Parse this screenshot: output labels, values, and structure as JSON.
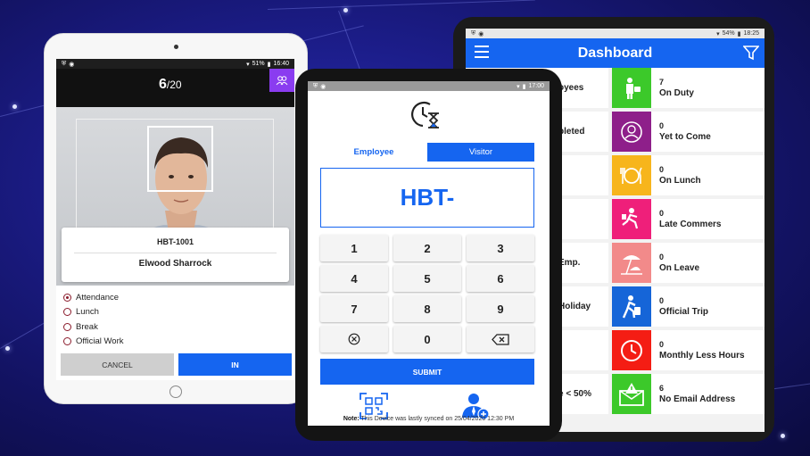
{
  "face_screen": {
    "status_time": "16:40",
    "status_battery": "51%",
    "counter_current": "6",
    "counter_total": "/20",
    "employee_code": "HBT-1001",
    "employee_name": "Elwood Sharrock",
    "options": [
      {
        "label": "Attendance",
        "selected": true
      },
      {
        "label": "Lunch",
        "selected": false
      },
      {
        "label": "Break",
        "selected": false
      },
      {
        "label": "Official Work",
        "selected": false
      }
    ],
    "cancel_label": "CANCEL",
    "in_label": "IN"
  },
  "keypad_screen": {
    "status_time": "17:00",
    "tab_employee": "Employee",
    "tab_visitor": "Visitor",
    "code_value": "HBT-",
    "keys": [
      "1",
      "2",
      "3",
      "4",
      "5",
      "6",
      "7",
      "8",
      "9",
      "",
      "0",
      ""
    ],
    "submit_label": "SUBMIT",
    "note_label": "Note:",
    "note_text": " This Device was lastly synced on 25/04/2020 12:30 PM"
  },
  "dashboard": {
    "status_time": "18:25",
    "status_battery": "54%",
    "title": "Dashboard",
    "left_labels": [
      "oyees",
      "pleted",
      "",
      "",
      "Emp.",
      "Holiday",
      "",
      "e < 50%"
    ],
    "tiles": [
      {
        "count": "7",
        "label": "On Duty",
        "color": "#3cc92a",
        "icon": "on-duty-icon"
      },
      {
        "count": "0",
        "label": "Yet to Come",
        "color": "#8e1f8a",
        "icon": "yet-to-come-icon"
      },
      {
        "count": "0",
        "label": "On Lunch",
        "color": "#f7b51c",
        "icon": "lunch-icon"
      },
      {
        "count": "0",
        "label": "Late Commers",
        "color": "#ef1f7a",
        "icon": "late-runner-icon"
      },
      {
        "count": "0",
        "label": "On Leave",
        "color": "#f28a8a",
        "icon": "beach-leave-icon"
      },
      {
        "count": "0",
        "label": "Official Trip",
        "color": "#1565d8",
        "icon": "trip-traveler-icon"
      },
      {
        "count": "0",
        "label": "Monthly Less Hours",
        "color": "#f41d14",
        "icon": "clock-icon"
      },
      {
        "count": "6",
        "label": "No Email Address",
        "color": "#3cc92a",
        "icon": "email-alert-icon"
      }
    ]
  }
}
